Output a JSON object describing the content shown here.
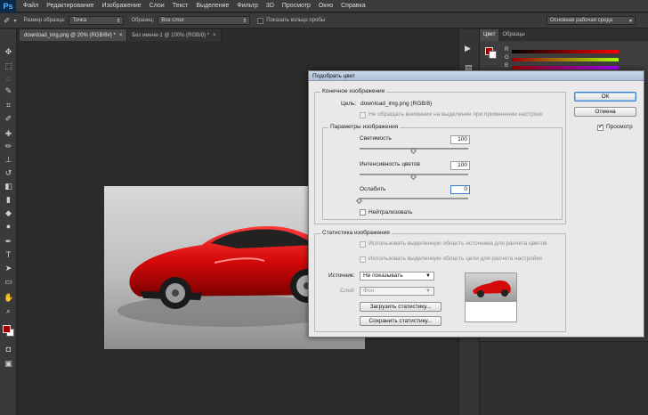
{
  "menu": {
    "logo": "Ps",
    "items": [
      "Файл",
      "Редактирование",
      "Изображение",
      "Слои",
      "Текст",
      "Выделение",
      "Фильтр",
      "3D",
      "Просмотр",
      "Окно",
      "Справка"
    ]
  },
  "options": {
    "sample_size_label": "Размер образца:",
    "sample_size_value": "Точка",
    "sample_label": "Образец:",
    "sample_value": "Все слои",
    "show_ring_label": "Показать кольцо пробы",
    "workspace": "Основная рабочая среда"
  },
  "tabs": [
    {
      "label": "download_img.png @ 20% (RGB/8#) *",
      "close": "×"
    },
    {
      "label": "Без имени-1 @ 100% (RGB/8) *",
      "close": "×"
    }
  ],
  "panel": {
    "tabs": [
      "Цвет",
      "Образцы"
    ],
    "channel_labels": [
      "R",
      "G",
      "B"
    ]
  },
  "colors": {
    "foreground": "#a10000",
    "background": "#ffffff",
    "accent": "#3c7fd3"
  },
  "dialog": {
    "title": "Подобрать цвет",
    "target_group": "Конечное изображение",
    "target_label": "Цель:",
    "target_value": "download_img.png (RGB/8)",
    "ignore_selection": "Не обращать внимания на выделение при применении настроек",
    "options_group": "Параметры изображения",
    "luminance_label": "Светимость",
    "luminance_value": "100",
    "luminance_level": 0.5,
    "intensity_label": "Интенсивность цветов",
    "intensity_value": "100",
    "intensity_level": 0.5,
    "fade_label": "Ослабить",
    "fade_value": "0",
    "fade_level": 0,
    "neutralize_label": "Нейтрализовать",
    "neutralize_checked": false,
    "stats_group": "Статистика изображения",
    "use_source_selection": "Использовать выделенную область источника для расчета цветов",
    "use_target_selection": "Использовать выделенную область цели для расчета настройки",
    "source_label": "Источник:",
    "source_value": "Не показывать",
    "layer_label": "Слой",
    "layer_value": "Фон",
    "load_stats": "Загрузить статистику...",
    "save_stats": "Сохранить статистику...",
    "ok": "ОК",
    "cancel": "Отмена",
    "preview_label": "Просмотр",
    "preview_checked": true
  }
}
